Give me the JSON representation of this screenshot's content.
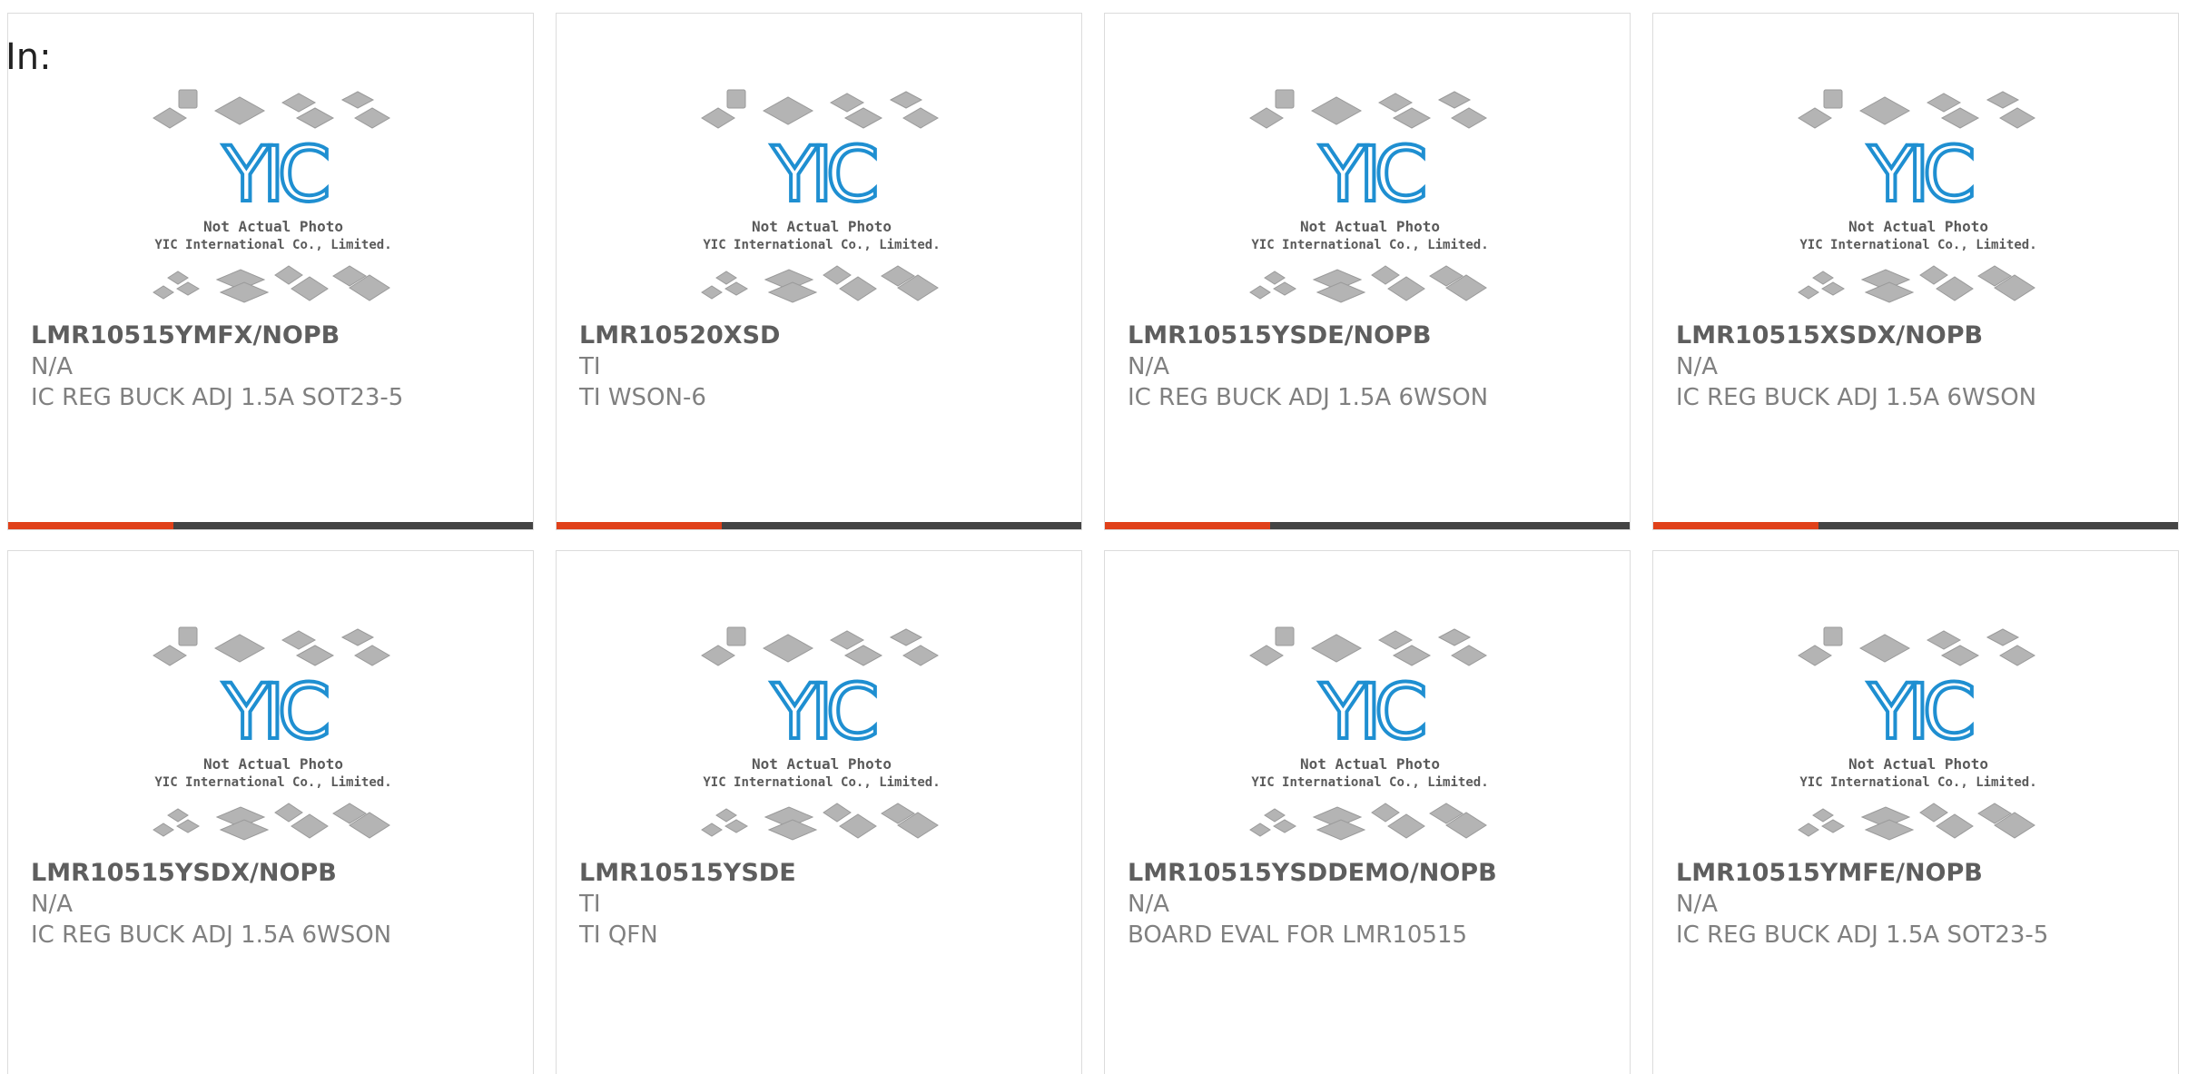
{
  "header": {
    "in_label": "In:"
  },
  "placeholder": {
    "line1": "Not Actual Photo",
    "line2": "YIC International Co., Limited.",
    "logo_text": "YIC"
  },
  "colors": {
    "accent": "#e0411a",
    "bar": "#444444",
    "logo_blue": "#1f8fd1"
  },
  "products": [
    {
      "part_number": "LMR10515YMFX/NOPB",
      "manufacturer": "N/A",
      "description": "IC REG BUCK ADJ 1.5A SOT23-5"
    },
    {
      "part_number": "LMR10520XSD",
      "manufacturer": "TI",
      "description": "TI WSON-6"
    },
    {
      "part_number": "LMR10515YSDE/NOPB",
      "manufacturer": "N/A",
      "description": "IC REG BUCK ADJ 1.5A 6WSON"
    },
    {
      "part_number": "LMR10515XSDX/NOPB",
      "manufacturer": "N/A",
      "description": "IC REG BUCK ADJ 1.5A 6WSON"
    },
    {
      "part_number": "LMR10515YSDX/NOPB",
      "manufacturer": "N/A",
      "description": "IC REG BUCK ADJ 1.5A 6WSON"
    },
    {
      "part_number": "LMR10515YSDE",
      "manufacturer": "TI",
      "description": "TI QFN"
    },
    {
      "part_number": "LMR10515YSDDEMO/NOPB",
      "manufacturer": "N/A",
      "description": "BOARD EVAL FOR LMR10515"
    },
    {
      "part_number": "LMR10515YMFE/NOPB",
      "manufacturer": "N/A",
      "description": "IC REG BUCK ADJ 1.5A SOT23-5"
    }
  ]
}
